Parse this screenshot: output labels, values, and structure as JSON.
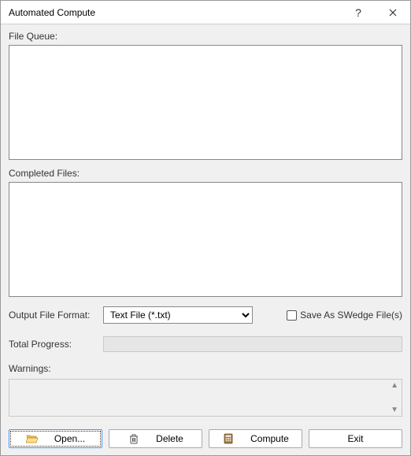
{
  "title": "Automated Compute",
  "labels": {
    "file_queue": "File Queue:",
    "completed_files": "Completed Files:",
    "output_format": "Output File Format:",
    "total_progress": "Total Progress:",
    "warnings": "Warnings:"
  },
  "file_queue": [],
  "completed_files": [],
  "output_format": {
    "selected": "Text File (*.txt)"
  },
  "save_as_swedge": {
    "checked": false,
    "label": "Save As SWedge File(s)"
  },
  "progress": 0,
  "warnings_text": "",
  "buttons": {
    "open": "Open...",
    "delete": "Delete",
    "compute": "Compute",
    "exit": "Exit"
  }
}
